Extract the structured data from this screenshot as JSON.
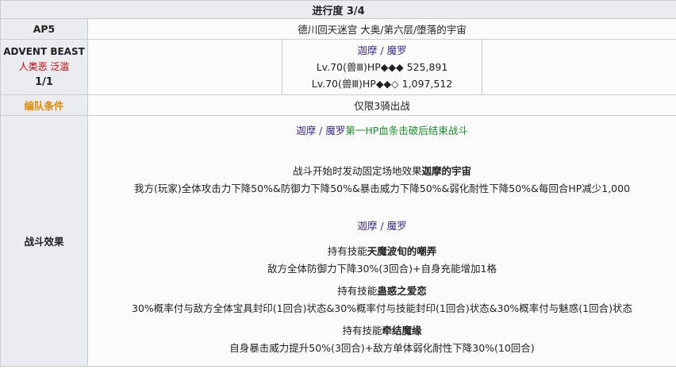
{
  "header": {
    "progress": "进行度 3/4"
  },
  "ap_row": {
    "label": "AP5",
    "location": "德川回天迷宫 大奥/第六层/堕落的宇宙"
  },
  "class_row": {
    "class_name": "ADVENT BEAST",
    "traits": "人类恶 泛滥",
    "count": "1/1",
    "enemy": {
      "name": "迦摩 / 魔罗",
      "line1": "Lv.70(兽Ⅲ)HP◆◆◆ 525,891",
      "line2": "Lv.70(兽Ⅲ)HP◆◆◇ 1,097,512"
    }
  },
  "formation_row": {
    "label": "编队条件",
    "value": "仅限3骑出战"
  },
  "effects_row": {
    "label": "战斗效果",
    "end_prefix": "迦摩 / 魔罗",
    "end_suffix": "第一HP血条击破后结束战斗",
    "field_prefix": "战斗开始时发动固定场地效果",
    "field_name": "迦摩的宇宙",
    "field_desc": "我方(玩家)全体攻击力下降50%&防御力下降50%&暴击威力下降50%&弱化耐性下降50%&每回合HP减少1,000",
    "boss_name": "迦摩 / 魔罗",
    "skill_prefix": "持有技能",
    "skill1_name": "天魔波旬的嘲弄",
    "skill1_desc": "敌方全体防御力下降30%(3回合)+自身充能增加1格",
    "skill2_name": "蛊惑之爱恋",
    "skill2_desc": "30%概率付与敌方全体宝具封印(1回合)状态&30%概率付与技能封印(1回合)状态&30%概率付与魅惑(1回合)状态",
    "skill3_name": "牵结魔缘",
    "skill3_desc": "自身暴击威力提升50%(3回合)+敌方单体弱化耐性下降30%(10回合)"
  }
}
